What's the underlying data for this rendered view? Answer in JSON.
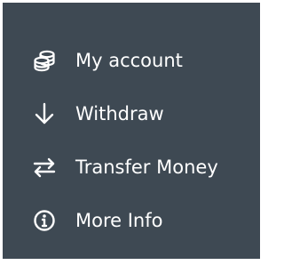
{
  "colors": {
    "panel_background": "#3e4953",
    "text": "#ffffff",
    "icon": "#ffffff"
  },
  "menu": {
    "items": [
      {
        "label": "My account",
        "icon": "coins-icon"
      },
      {
        "label": "Withdraw",
        "icon": "arrow-down-icon"
      },
      {
        "label": "Transfer Money",
        "icon": "transfer-arrows-icon"
      },
      {
        "label": "More Info",
        "icon": "info-icon"
      }
    ]
  }
}
